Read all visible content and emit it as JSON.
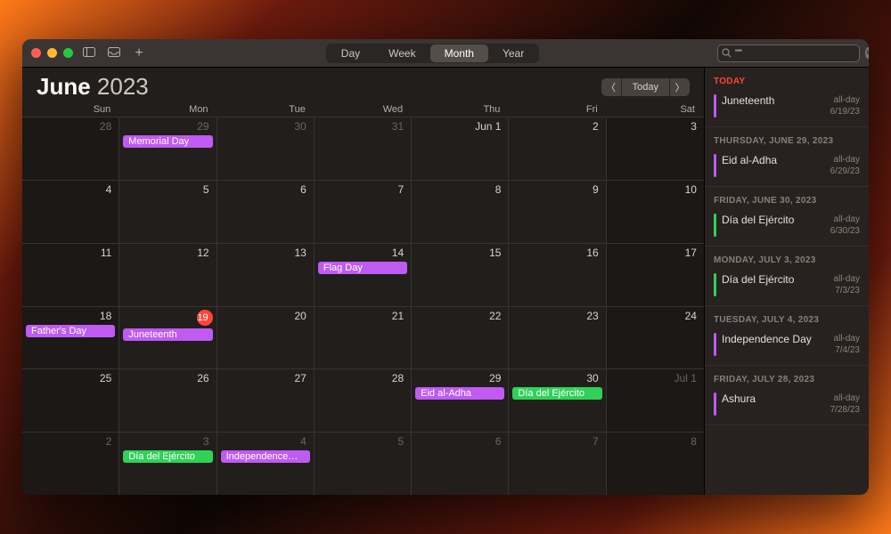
{
  "toolbar": {
    "views": [
      "Day",
      "Week",
      "Month",
      "Year"
    ],
    "selected_view": "Month",
    "search_value": "\"\""
  },
  "header": {
    "month": "June",
    "year": "2023",
    "today_label": "Today"
  },
  "dow": [
    "Sun",
    "Mon",
    "Tue",
    "Wed",
    "Thu",
    "Fri",
    "Sat"
  ],
  "grid": [
    {
      "n": "28",
      "dim": true,
      "w": true
    },
    {
      "n": "29",
      "dim": true,
      "ev": [
        {
          "t": "Memorial Day",
          "c": "purple"
        }
      ]
    },
    {
      "n": "30",
      "dim": true
    },
    {
      "n": "31",
      "dim": true
    },
    {
      "n": "Jun 1"
    },
    {
      "n": "2"
    },
    {
      "n": "3",
      "w": true
    },
    {
      "n": "4",
      "w": true
    },
    {
      "n": "5"
    },
    {
      "n": "6"
    },
    {
      "n": "7"
    },
    {
      "n": "8"
    },
    {
      "n": "9"
    },
    {
      "n": "10",
      "w": true
    },
    {
      "n": "11",
      "w": true
    },
    {
      "n": "12"
    },
    {
      "n": "13"
    },
    {
      "n": "14",
      "ev": [
        {
          "t": "Flag Day",
          "c": "purple"
        }
      ]
    },
    {
      "n": "15"
    },
    {
      "n": "16"
    },
    {
      "n": "17",
      "w": true
    },
    {
      "n": "18",
      "w": true,
      "ev": [
        {
          "t": "Father's Day",
          "c": "purple"
        }
      ]
    },
    {
      "n": "19",
      "today": true,
      "ev": [
        {
          "t": "Juneteenth",
          "c": "purple"
        }
      ]
    },
    {
      "n": "20"
    },
    {
      "n": "21"
    },
    {
      "n": "22"
    },
    {
      "n": "23"
    },
    {
      "n": "24",
      "w": true
    },
    {
      "n": "25",
      "w": true
    },
    {
      "n": "26"
    },
    {
      "n": "27"
    },
    {
      "n": "28"
    },
    {
      "n": "29",
      "ev": [
        {
          "t": "Eid al-Adha",
          "c": "purple"
        }
      ]
    },
    {
      "n": "30",
      "ev": [
        {
          "t": "Día del Ejército",
          "c": "green"
        }
      ]
    },
    {
      "n": "Jul 1",
      "dim": true,
      "w": true
    },
    {
      "n": "2",
      "dim": true,
      "w": true
    },
    {
      "n": "3",
      "dim": true,
      "ev": [
        {
          "t": "Día del Ejército",
          "c": "green"
        }
      ]
    },
    {
      "n": "4",
      "dim": true,
      "ev": [
        {
          "t": "Independence…",
          "c": "purple"
        }
      ]
    },
    {
      "n": "5",
      "dim": true
    },
    {
      "n": "6",
      "dim": true
    },
    {
      "n": "7",
      "dim": true
    },
    {
      "n": "8",
      "dim": true,
      "w": true
    }
  ],
  "sidebar": [
    {
      "hdr": "Today",
      "today": true
    },
    {
      "title": "Juneteenth",
      "time": "all-day",
      "date": "6/19/23",
      "c": "purple"
    },
    {
      "hdr": "Thursday, June 29, 2023"
    },
    {
      "title": "Eid al-Adha",
      "time": "all-day",
      "date": "6/29/23",
      "c": "purple"
    },
    {
      "hdr": "Friday, June 30, 2023"
    },
    {
      "title": "Día del Ejército",
      "time": "all-day",
      "date": "6/30/23",
      "c": "green"
    },
    {
      "hdr": "Monday, July 3, 2023"
    },
    {
      "title": "Día del Ejército",
      "time": "all-day",
      "date": "7/3/23",
      "c": "green"
    },
    {
      "hdr": "Tuesday, July 4, 2023"
    },
    {
      "title": "Independence Day",
      "time": "all-day",
      "date": "7/4/23",
      "c": "purple"
    },
    {
      "hdr": "Friday, July 28, 2023"
    },
    {
      "title": "Ashura",
      "time": "all-day",
      "date": "7/28/23",
      "c": "purple"
    }
  ]
}
